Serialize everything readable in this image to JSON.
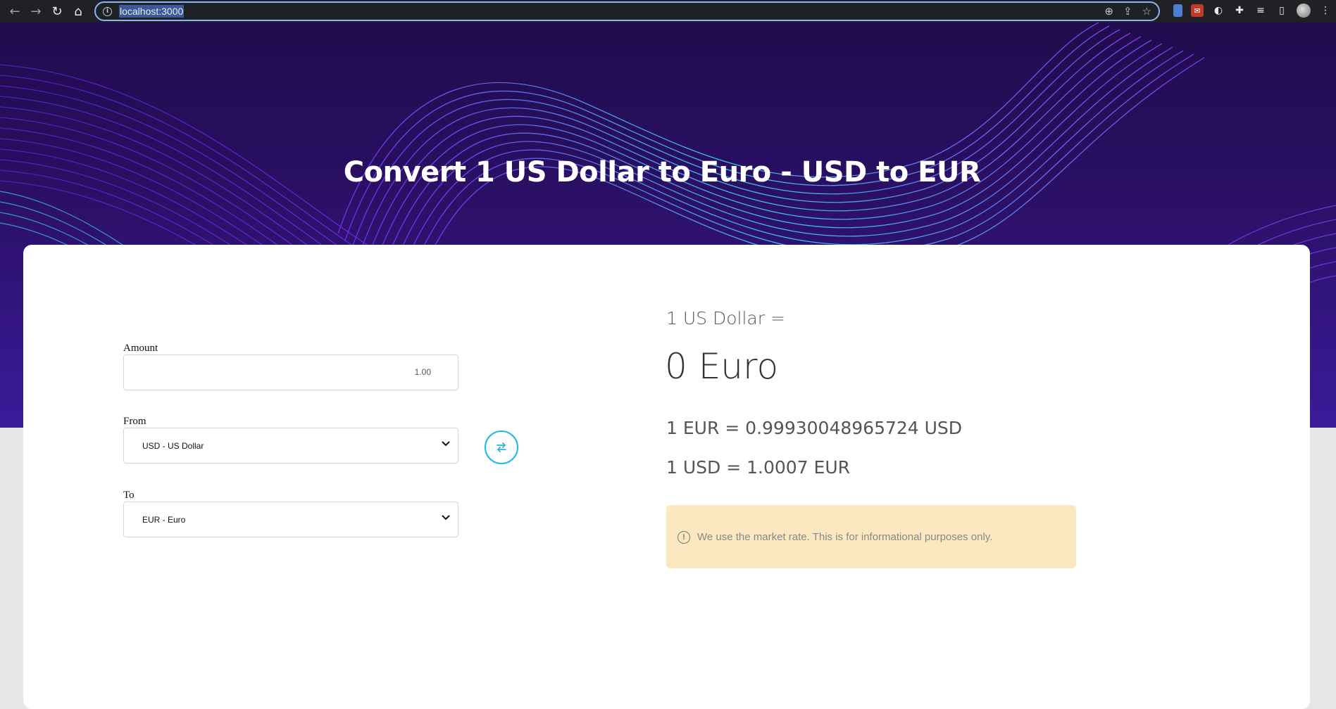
{
  "browser": {
    "url": "localhost:3000",
    "back_icon": "arrow-left-icon",
    "forward_icon": "arrow-right-icon",
    "reload_icon": "reload-icon",
    "home_icon": "home-icon"
  },
  "hero": {
    "title": "Convert 1 US Dollar to Euro - USD to EUR"
  },
  "form": {
    "amount_label": "Amount",
    "amount_value": "1.00",
    "from_label": "From",
    "from_value": "USD - US Dollar",
    "to_label": "To",
    "to_value": "EUR - Euro"
  },
  "result": {
    "from_text": "1 US Dollar =",
    "to_text": "0 Euro",
    "rate_eur_usd": "1 EUR = 0.99930048965724 USD",
    "rate_usd_eur": "1 USD = 1.0007 EUR",
    "notice": "We use the market rate. This is for informational purposes only."
  },
  "colors": {
    "accent": "#23b7e5",
    "notice_bg": "#fbe8c0",
    "hero_bg": "#2a0f63"
  }
}
